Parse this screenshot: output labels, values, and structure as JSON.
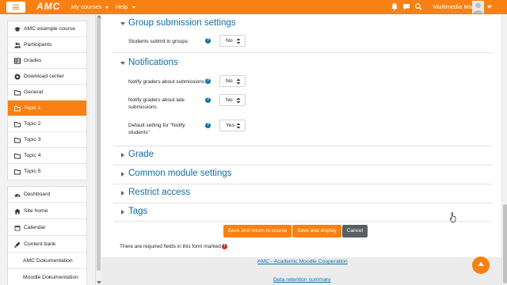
{
  "navbar": {
    "menu_icon": "hamburger-icon",
    "logo": "AMC",
    "my_courses": "My courses",
    "help": "Help",
    "user_name": "Multimedia Mas",
    "icons": [
      "bell-icon",
      "chat-icon",
      "search-icon"
    ]
  },
  "drawer": {
    "group1": [
      {
        "label": "AMC example course",
        "icon": "graduation-cap-icon"
      },
      {
        "label": "Participants",
        "icon": "users-icon"
      },
      {
        "label": "Grades",
        "icon": "table-icon"
      },
      {
        "label": "Download center",
        "icon": "download-circle-icon"
      },
      {
        "label": "General",
        "icon": "folder-icon"
      },
      {
        "label": "Topic 1",
        "icon": "folder-icon",
        "active": true
      },
      {
        "label": "Topic 2",
        "icon": "folder-icon"
      },
      {
        "label": "Topic 3",
        "icon": "folder-icon"
      },
      {
        "label": "Topic 4",
        "icon": "folder-icon"
      },
      {
        "label": "Topic 5",
        "icon": "folder-icon"
      }
    ],
    "group2": [
      {
        "label": "Dashboard",
        "icon": "dashboard-icon"
      },
      {
        "label": "Site home",
        "icon": "home-icon"
      },
      {
        "label": "Calendar",
        "icon": "calendar-icon"
      },
      {
        "label": "Content bank",
        "icon": "paint-icon"
      },
      {
        "label": "AMC Dokumentation",
        "icon": ""
      },
      {
        "label": "Moodle Dokumentation",
        "icon": ""
      }
    ]
  },
  "form": {
    "group_submission": {
      "title": "Group submission settings",
      "students_submit_label": "Students submit in groups",
      "students_submit_value": "No"
    },
    "notifications": {
      "title": "Notifications",
      "notify_graders_label": "Notify graders about submissions",
      "notify_graders_value": "No",
      "notify_late_label_line1": "Notify graders about late",
      "notify_late_label_line2": "submissions",
      "notify_late_value": "No",
      "default_notify_label_line1": "Default setting for \"Notify",
      "default_notify_label_line2": "students\"",
      "default_notify_value": "Yes"
    },
    "collapsed_sections": [
      "Grade",
      "Common module settings",
      "Restrict access",
      "Tags"
    ],
    "buttons": {
      "save_return": "Save and return to course",
      "save_display": "Save and display",
      "cancel": "Cancel"
    },
    "required_note": "There are required fields in this form marked",
    "help_glyph": "?",
    "required_glyph": "!"
  },
  "footer": {
    "link1": "AMC - Academic Moodle Cooperation",
    "link2": "Data retention summary"
  },
  "colors": {
    "brand": "#f98012",
    "link": "#0f6fa5",
    "secondary_button": "#5a5f63",
    "required": "#ca3120"
  }
}
